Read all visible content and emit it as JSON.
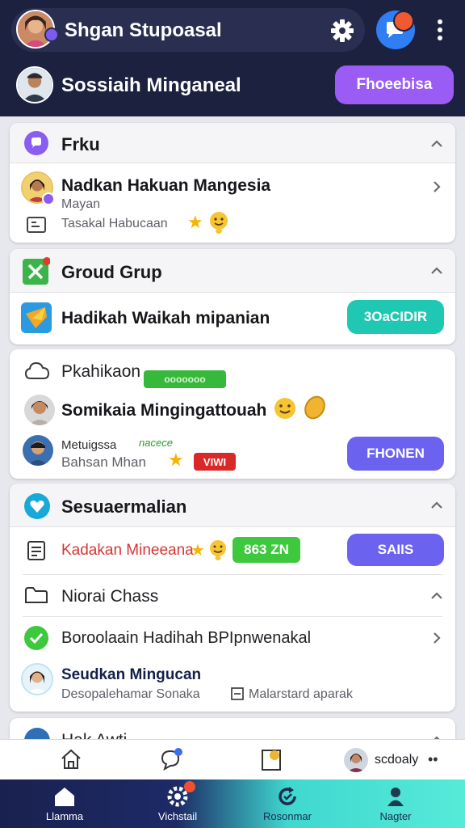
{
  "header": {
    "app_title": "Shgan Stupoasal",
    "user_name": "Sossiaih Minganeal",
    "primary_button": "Fhoeebisa",
    "icons": [
      "gear-icon",
      "notification-icon",
      "more-icon"
    ]
  },
  "sections": {
    "friends": {
      "title": "Frku",
      "item": {
        "name": "Nadkan Hakuan Mangesia",
        "subtitle": "Mayan",
        "detail": "Tasakal Habucaan"
      }
    },
    "group": {
      "title": "Groud Grup",
      "item": {
        "name": "Hadikah Waikah mipanian",
        "button": "3OaCIDIR"
      }
    },
    "feed": {
      "title": "Pkahikaon",
      "tag": "ooooooo",
      "person": {
        "name": "Somikaia Mingingattouah",
        "line1": "Metuigssa",
        "line1_tag": "nacece",
        "line2": "Bahsan Mhan",
        "badge": "VIWI",
        "button": "FHONEN"
      }
    },
    "notifications": {
      "title": "Sesuaermalian",
      "item": {
        "name": "Kadakan Mineeana",
        "count_badge": "863 ZN",
        "button": "SAIIS"
      },
      "subheading": "Niorai Chass",
      "link": "Boroolaain Hadihah BPIpnwenakal",
      "person": {
        "name": "Seudkan Mingucan",
        "line1": "Desopalehamar Sonaka",
        "line2": "Malarstard aparak"
      }
    },
    "peek": {
      "title": "Hak Awti"
    }
  },
  "toolbar": {
    "profile_name": "scdoaly",
    "icons": [
      "home-icon",
      "chat-icon",
      "bookmark-icon",
      "more-icon"
    ]
  },
  "tabbar": {
    "tabs": [
      {
        "label": "Llamma",
        "icon": "home-icon"
      },
      {
        "label": "Vichstail",
        "icon": "settings-icon"
      },
      {
        "label": "Rosonmar",
        "icon": "refresh-icon"
      },
      {
        "label": "Nagter",
        "icon": "person-icon"
      }
    ]
  },
  "colors": {
    "header_bg": "#1d2140",
    "primary_purple": "#9b5cf5",
    "button_purple": "#6b63ef",
    "teal": "#1ec8b2",
    "green": "#3ec83e",
    "alert_red": "#d92828"
  }
}
